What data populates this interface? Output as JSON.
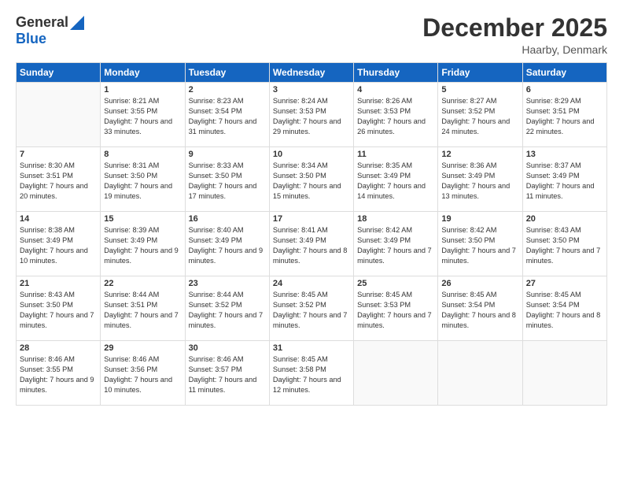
{
  "header": {
    "logo_general": "General",
    "logo_blue": "Blue",
    "month_title": "December 2025",
    "location": "Haarby, Denmark"
  },
  "days_of_week": [
    "Sunday",
    "Monday",
    "Tuesday",
    "Wednesday",
    "Thursday",
    "Friday",
    "Saturday"
  ],
  "weeks": [
    [
      {
        "day": "",
        "info": ""
      },
      {
        "day": "1",
        "info": "Sunrise: 8:21 AM\nSunset: 3:55 PM\nDaylight: 7 hours\nand 33 minutes."
      },
      {
        "day": "2",
        "info": "Sunrise: 8:23 AM\nSunset: 3:54 PM\nDaylight: 7 hours\nand 31 minutes."
      },
      {
        "day": "3",
        "info": "Sunrise: 8:24 AM\nSunset: 3:53 PM\nDaylight: 7 hours\nand 29 minutes."
      },
      {
        "day": "4",
        "info": "Sunrise: 8:26 AM\nSunset: 3:53 PM\nDaylight: 7 hours\nand 26 minutes."
      },
      {
        "day": "5",
        "info": "Sunrise: 8:27 AM\nSunset: 3:52 PM\nDaylight: 7 hours\nand 24 minutes."
      },
      {
        "day": "6",
        "info": "Sunrise: 8:29 AM\nSunset: 3:51 PM\nDaylight: 7 hours\nand 22 minutes."
      }
    ],
    [
      {
        "day": "7",
        "info": "Sunrise: 8:30 AM\nSunset: 3:51 PM\nDaylight: 7 hours\nand 20 minutes."
      },
      {
        "day": "8",
        "info": "Sunrise: 8:31 AM\nSunset: 3:50 PM\nDaylight: 7 hours\nand 19 minutes."
      },
      {
        "day": "9",
        "info": "Sunrise: 8:33 AM\nSunset: 3:50 PM\nDaylight: 7 hours\nand 17 minutes."
      },
      {
        "day": "10",
        "info": "Sunrise: 8:34 AM\nSunset: 3:50 PM\nDaylight: 7 hours\nand 15 minutes."
      },
      {
        "day": "11",
        "info": "Sunrise: 8:35 AM\nSunset: 3:49 PM\nDaylight: 7 hours\nand 14 minutes."
      },
      {
        "day": "12",
        "info": "Sunrise: 8:36 AM\nSunset: 3:49 PM\nDaylight: 7 hours\nand 13 minutes."
      },
      {
        "day": "13",
        "info": "Sunrise: 8:37 AM\nSunset: 3:49 PM\nDaylight: 7 hours\nand 11 minutes."
      }
    ],
    [
      {
        "day": "14",
        "info": "Sunrise: 8:38 AM\nSunset: 3:49 PM\nDaylight: 7 hours\nand 10 minutes."
      },
      {
        "day": "15",
        "info": "Sunrise: 8:39 AM\nSunset: 3:49 PM\nDaylight: 7 hours\nand 9 minutes."
      },
      {
        "day": "16",
        "info": "Sunrise: 8:40 AM\nSunset: 3:49 PM\nDaylight: 7 hours\nand 9 minutes."
      },
      {
        "day": "17",
        "info": "Sunrise: 8:41 AM\nSunset: 3:49 PM\nDaylight: 7 hours\nand 8 minutes."
      },
      {
        "day": "18",
        "info": "Sunrise: 8:42 AM\nSunset: 3:49 PM\nDaylight: 7 hours\nand 7 minutes."
      },
      {
        "day": "19",
        "info": "Sunrise: 8:42 AM\nSunset: 3:50 PM\nDaylight: 7 hours\nand 7 minutes."
      },
      {
        "day": "20",
        "info": "Sunrise: 8:43 AM\nSunset: 3:50 PM\nDaylight: 7 hours\nand 7 minutes."
      }
    ],
    [
      {
        "day": "21",
        "info": "Sunrise: 8:43 AM\nSunset: 3:50 PM\nDaylight: 7 hours\nand 7 minutes."
      },
      {
        "day": "22",
        "info": "Sunrise: 8:44 AM\nSunset: 3:51 PM\nDaylight: 7 hours\nand 7 minutes."
      },
      {
        "day": "23",
        "info": "Sunrise: 8:44 AM\nSunset: 3:52 PM\nDaylight: 7 hours\nand 7 minutes."
      },
      {
        "day": "24",
        "info": "Sunrise: 8:45 AM\nSunset: 3:52 PM\nDaylight: 7 hours\nand 7 minutes."
      },
      {
        "day": "25",
        "info": "Sunrise: 8:45 AM\nSunset: 3:53 PM\nDaylight: 7 hours\nand 7 minutes."
      },
      {
        "day": "26",
        "info": "Sunrise: 8:45 AM\nSunset: 3:54 PM\nDaylight: 7 hours\nand 8 minutes."
      },
      {
        "day": "27",
        "info": "Sunrise: 8:45 AM\nSunset: 3:54 PM\nDaylight: 7 hours\nand 8 minutes."
      }
    ],
    [
      {
        "day": "28",
        "info": "Sunrise: 8:46 AM\nSunset: 3:55 PM\nDaylight: 7 hours\nand 9 minutes."
      },
      {
        "day": "29",
        "info": "Sunrise: 8:46 AM\nSunset: 3:56 PM\nDaylight: 7 hours\nand 10 minutes."
      },
      {
        "day": "30",
        "info": "Sunrise: 8:46 AM\nSunset: 3:57 PM\nDaylight: 7 hours\nand 11 minutes."
      },
      {
        "day": "31",
        "info": "Sunrise: 8:45 AM\nSunset: 3:58 PM\nDaylight: 7 hours\nand 12 minutes."
      },
      {
        "day": "",
        "info": ""
      },
      {
        "day": "",
        "info": ""
      },
      {
        "day": "",
        "info": ""
      }
    ]
  ]
}
